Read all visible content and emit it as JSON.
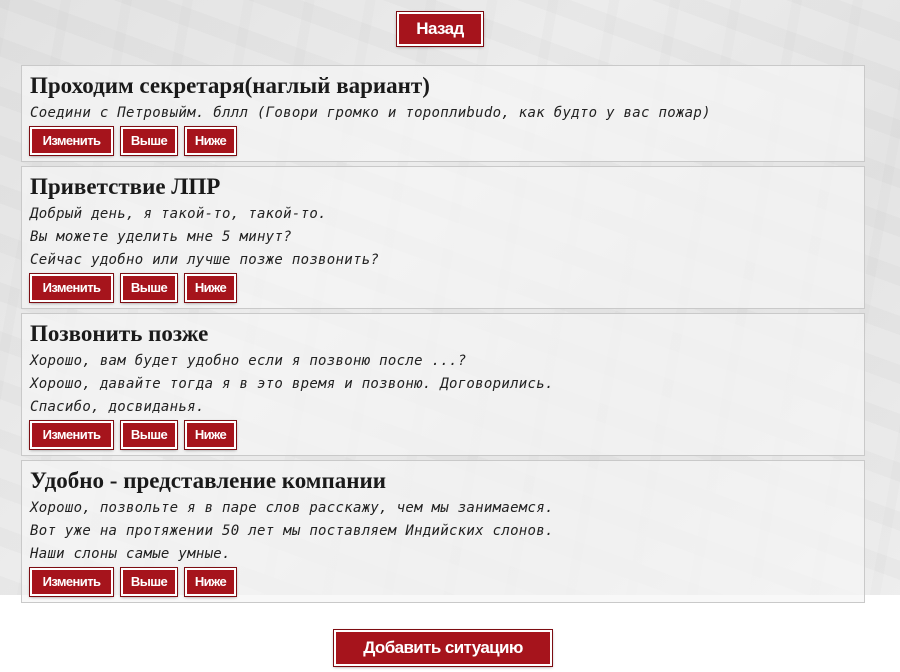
{
  "back_label": "Назад",
  "add_label": "Добавить ситуацию",
  "action_labels": {
    "edit": "Изменить",
    "up": "Выше",
    "down": "Ниже"
  },
  "situations": [
    {
      "title": "Проходим секретаря(наглый вариант)",
      "lines": [
        "Соедини с Петровыйм. бллл (Говори громко и тороплиbudo, как будто у вас пожар)"
      ]
    },
    {
      "title": "Приветствие ЛПР",
      "lines": [
        "Добрый день, я такой-то, такой-то.",
        "Вы можете уделить мне 5 минут?",
        "Сейчас удобно или лучше позже позвонить?"
      ]
    },
    {
      "title": "Позвонить позже",
      "lines": [
        "Хорошо, вам будет удобно если я позвоню после ...?",
        "Хорошо, давайте тогда я в это время и позвоню. Договорились.",
        "Спасибо, досвиданья."
      ]
    },
    {
      "title": "Удобно - представление компании",
      "lines": [
        "Хорошо, позвольте я в паре слов расскажу, чем мы занимаемся.",
        "Вот уже на протяжении 50 лет мы поставляем Индийских слонов.",
        "Наши слоны самые умные."
      ]
    }
  ],
  "colors": {
    "button_bg": "#a6141c",
    "button_text": "#ffffff",
    "card_border": "#c9c9c9"
  }
}
